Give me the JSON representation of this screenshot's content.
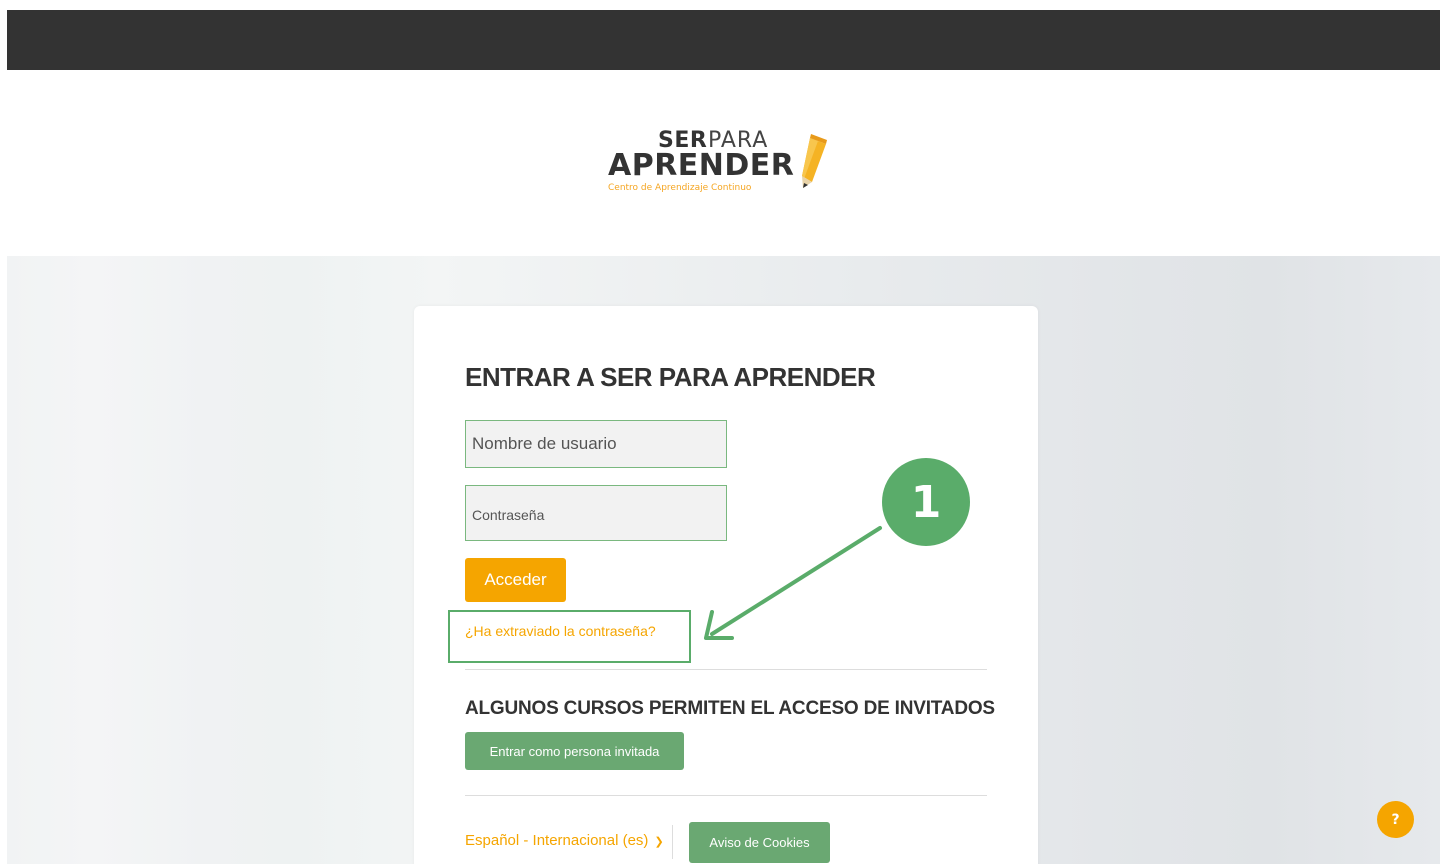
{
  "logo": {
    "word_ser": "SER",
    "word_para": "PARA",
    "word_aprender": "APRENDER",
    "tagline": "Centro de Aprendizaje Continuo",
    "icon": "pencil-icon"
  },
  "login": {
    "title": "ENTRAR A SER PARA APRENDER",
    "username_placeholder": "Nombre de usuario",
    "password_placeholder": "Contraseña",
    "submit_label": "Acceder",
    "forgot_link": "¿Ha extraviado la contraseña?"
  },
  "guest": {
    "title": "ALGUNOS CURSOS PERMITEN EL ACCESO DE INVITADOS",
    "button_label": "Entrar como persona invitada"
  },
  "footer": {
    "language_label": "Español - Internacional (es)",
    "language_icon": "chevron-down-icon",
    "cookies_label": "Aviso de Cookies"
  },
  "annotation": {
    "step_number": "1",
    "color": "#5aac6a"
  },
  "help": {
    "label": "?",
    "icon": "question-icon"
  },
  "colors": {
    "accent": "#f5a500",
    "green": "#6aa872",
    "topbar": "#333333"
  }
}
